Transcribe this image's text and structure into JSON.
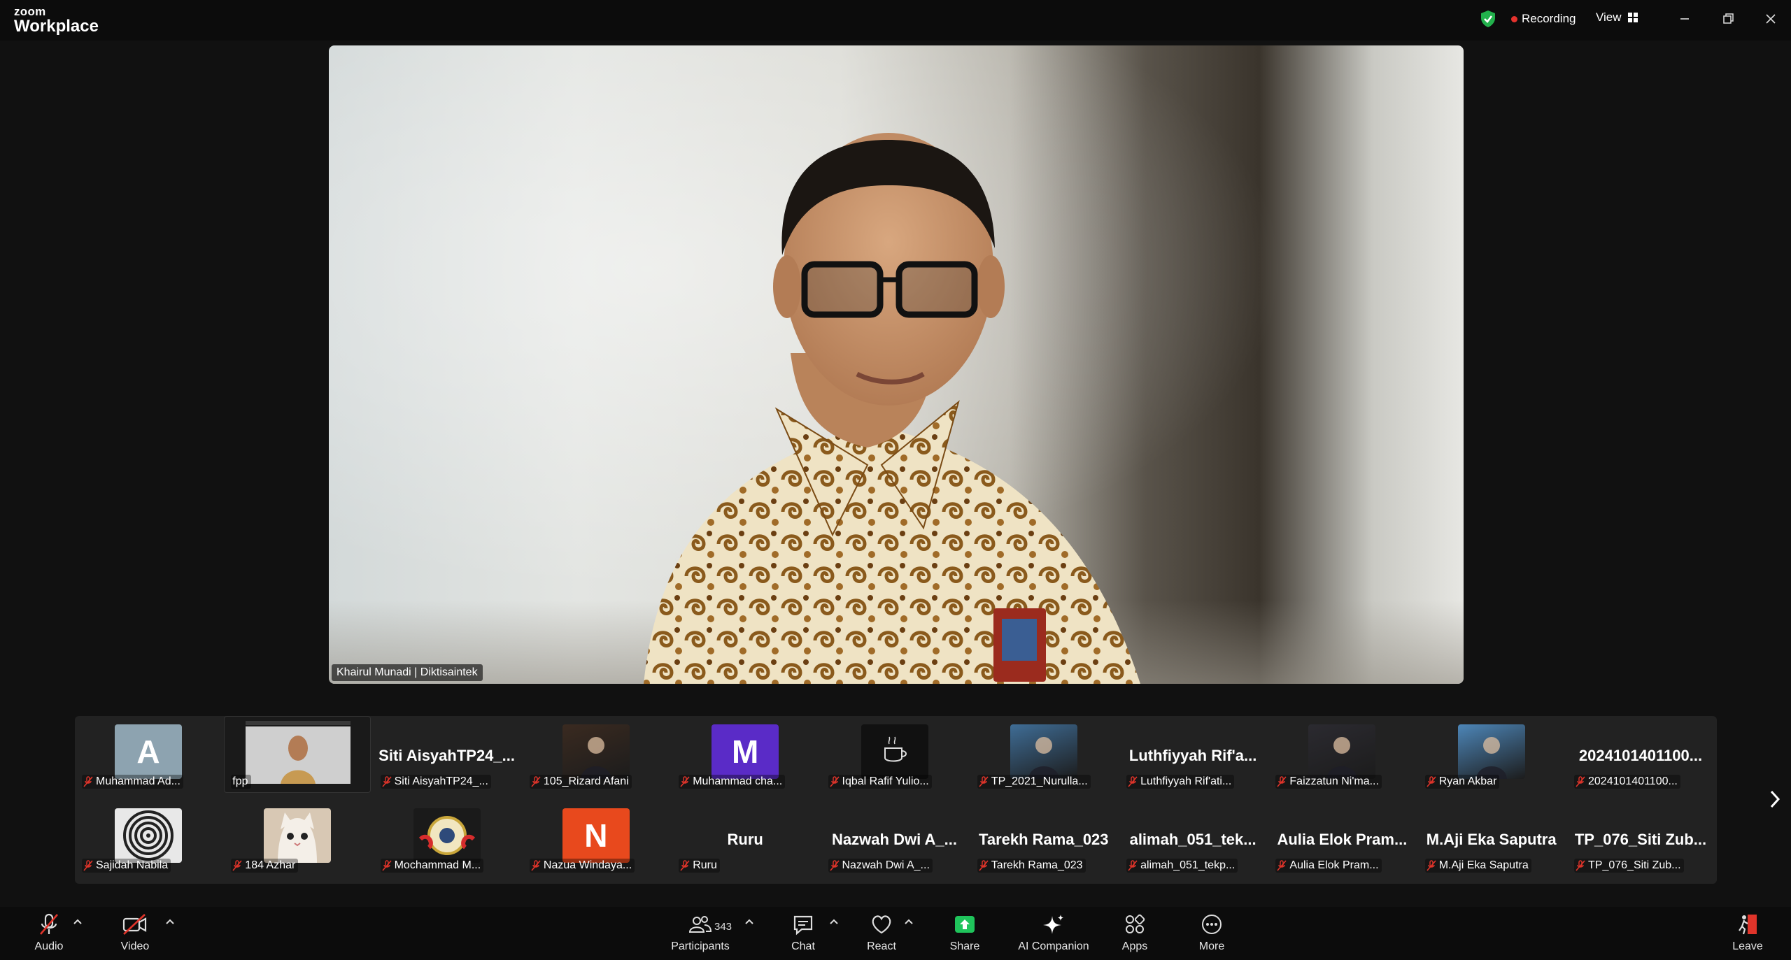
{
  "app": {
    "logo_top": "zoom",
    "logo_bottom": "Workplace"
  },
  "titlebar": {
    "recording_label": "Recording",
    "view_label": "View"
  },
  "main_video": {
    "speaker_name": "Khairul Munadi | Diktisaintek"
  },
  "gallery": {
    "row1": [
      {
        "label": "Muhammad Ad...",
        "avatar": "letter",
        "letter": "A",
        "color": "#8da3b0"
      },
      {
        "label": "fpp",
        "avatar": "screen"
      },
      {
        "label": "Siti AisyahTP24_...",
        "avatar": "name",
        "bigname": "Siti AisyahTP24_..."
      },
      {
        "label": "105_Rizard Afani",
        "avatar": "photo",
        "color": "#3a2a20"
      },
      {
        "label": "Muhammad cha...",
        "avatar": "letter",
        "letter": "M",
        "color": "#5a2bc7"
      },
      {
        "label": "Iqbal Rafif Yulio...",
        "avatar": "coffee",
        "color": "#111111"
      },
      {
        "label": "TP_2021_Nurulla...",
        "avatar": "photo",
        "color": "#3f6d96"
      },
      {
        "label": "Luthfiyyah Rif'ati...",
        "avatar": "name",
        "bigname": "Luthfiyyah Rif'a..."
      },
      {
        "label": "Faizzatun Ni'ma...",
        "avatar": "photo",
        "color": "#2b2a30"
      },
      {
        "label": "Ryan Akbar",
        "avatar": "photo",
        "color": "#4d86b8"
      },
      {
        "label": "2024101401100...",
        "avatar": "name",
        "bigname": "2024101401100..."
      }
    ],
    "row2": [
      {
        "label": "Sajidah Nabila",
        "avatar": "spiral",
        "color": "#e8e8e8"
      },
      {
        "label": "184 Azhar",
        "avatar": "cat",
        "color": "#d8c8b4"
      },
      {
        "label": "Mochammad M...",
        "avatar": "emblem",
        "color": "#1a1a1a"
      },
      {
        "label": "Nazua Windaya...",
        "avatar": "letter",
        "letter": "N",
        "color": "#e8491d"
      },
      {
        "label": "Ruru",
        "avatar": "name",
        "bigname": "Ruru"
      },
      {
        "label": "Nazwah Dwi A_...",
        "avatar": "name",
        "bigname": "Nazwah Dwi A_..."
      },
      {
        "label": "Tarekh Rama_023",
        "avatar": "name",
        "bigname": "Tarekh Rama_023"
      },
      {
        "label": "alimah_051_tekp...",
        "avatar": "name",
        "bigname": "alimah_051_tek..."
      },
      {
        "label": "Aulia Elok Pram...",
        "avatar": "name",
        "bigname": "Aulia Elok Pram..."
      },
      {
        "label": "M.Aji Eka Saputra",
        "avatar": "name",
        "bigname": "M.Aji Eka Saputra"
      },
      {
        "label": "TP_076_Siti Zub...",
        "avatar": "name",
        "bigname": "TP_076_Siti Zub..."
      }
    ]
  },
  "toolbar": {
    "audio": "Audio",
    "video": "Video",
    "participants": "Participants",
    "participants_count": "343",
    "chat": "Chat",
    "react": "React",
    "share": "Share",
    "ai_companion": "AI Companion",
    "apps": "Apps",
    "more": "More",
    "leave": "Leave"
  },
  "colors": {
    "share_green": "#1fc45b",
    "recording_red": "#e5322d",
    "mute_red": "#e0342a",
    "leave_red": "#e0342a"
  }
}
